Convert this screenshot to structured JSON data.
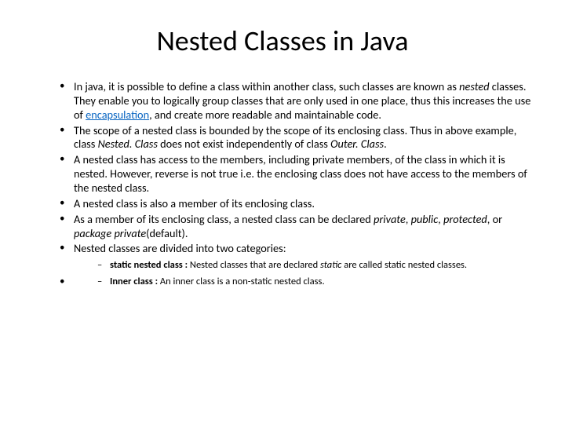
{
  "title": "Nested Classes in Java",
  "bullets": {
    "b1_a": "In java, it is possible to define a class within another class, such classes are known as ",
    "b1_b": "nested",
    "b1_c": " classes. They enable you to logically group classes that are only used in one place, thus this increases the use of ",
    "b1_d": "encapsulation",
    "b1_e": ", and create more readable and maintainable code.",
    "b2_a": "The scope of a nested class is bounded by the scope of its enclosing class. Thus in above example, class ",
    "b2_b": "Nested. Class",
    "b2_c": " does not exist independently of class ",
    "b2_d": "Outer. Class",
    "b2_e": ".",
    "b3": "A nested class has access to the members, including private members, of the class in which it is nested. However, reverse is not true i.e. the enclosing class does not have access to the members of the nested class.",
    "b4": "A nested class is also a member of its enclosing class.",
    "b5_a": "As a member of its enclosing class, a nested class can be declared ",
    "b5_b": "private",
    "b5_c": ", ",
    "b5_d": "public",
    "b5_e": ", ",
    "b5_f": "protected",
    "b5_g": ", or ",
    "b5_h": "package private",
    "b5_i": "(default).",
    "b6": "Nested classes are divided into two categories:",
    "s1_a": "static nested class : ",
    "s1_b": "Nested classes that are declared ",
    "s1_c": "static",
    "s1_d": " are called static nested classes.",
    "s2_a": "Inner class : ",
    "s2_b": "An inner class is a non-static nested class."
  }
}
